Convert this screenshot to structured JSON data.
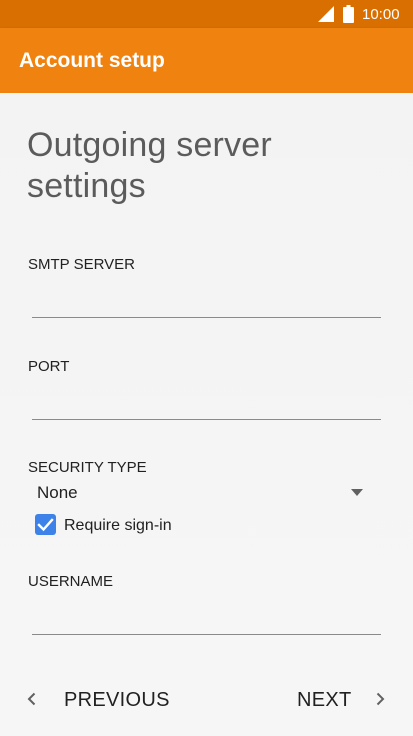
{
  "status_bar": {
    "time": "10:00",
    "icons": [
      "signal-icon",
      "battery-icon"
    ]
  },
  "app_bar": {
    "title": "Account setup"
  },
  "page": {
    "heading": "Outgoing server settings"
  },
  "fields": {
    "smtp_server": {
      "label": "SMTP SERVER",
      "value": ""
    },
    "port": {
      "label": "PORT",
      "value": ""
    },
    "security_type": {
      "label": "SECURITY TYPE",
      "value": "None"
    },
    "require_signin": {
      "label": "Require sign-in",
      "checked": true
    },
    "username": {
      "label": "USERNAME",
      "value": ""
    }
  },
  "navigation": {
    "previous_label": "PREVIOUS",
    "next_label": "NEXT"
  },
  "colors": {
    "status_bar": "#d86f00",
    "app_bar": "#f0820f",
    "checkbox": "#3c82e8",
    "background": "#f5f5f5"
  }
}
